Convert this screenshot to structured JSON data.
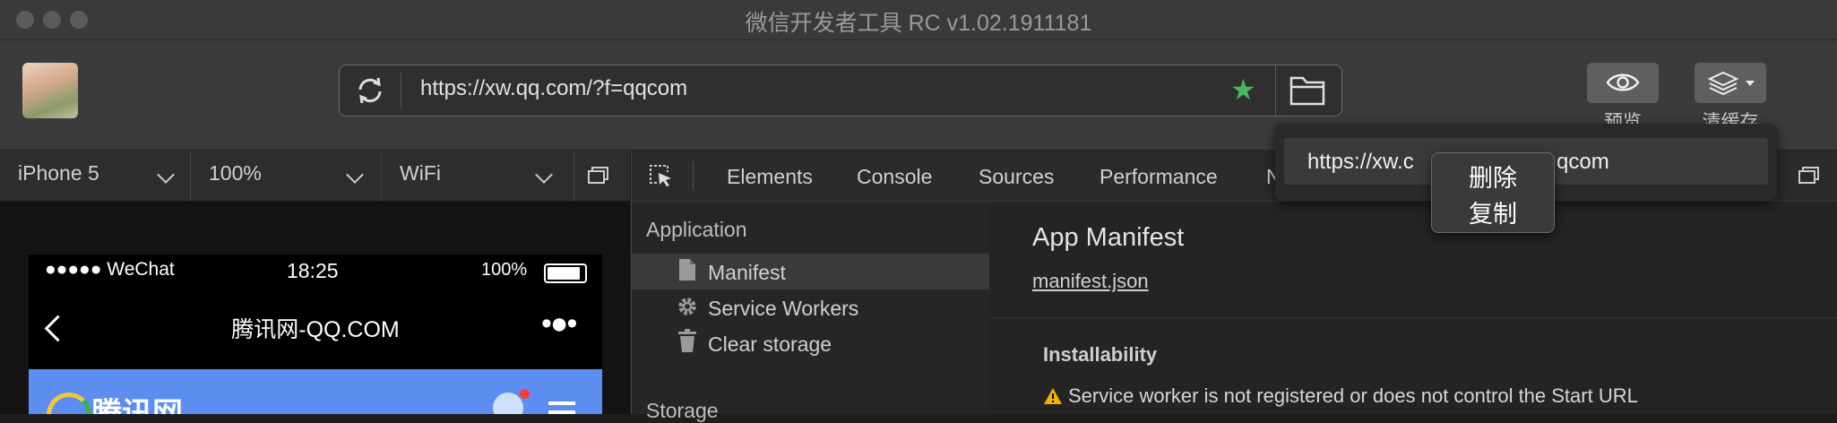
{
  "window": {
    "title": "微信开发者工具 RC v1.02.1911181"
  },
  "toolbar": {
    "url": "https://xw.qq.com/?f=qqcom",
    "preview_label": "预览",
    "clear_cache_label": "清缓存"
  },
  "device_bar": {
    "device": "iPhone 5",
    "zoom": "100%",
    "network": "WiFi"
  },
  "simulator": {
    "status_carrier": "●●●●● WeChat",
    "status_time": "18:25",
    "status_battery": "100%",
    "nav_title": "腾讯网-QQ.COM",
    "nav_more": "•●•",
    "logo_text": "腾讯网"
  },
  "devtools": {
    "tabs": [
      "Elements",
      "Console",
      "Sources",
      "Performance",
      "N"
    ],
    "sidebar": {
      "heading": "Application",
      "items": [
        {
          "label": "Manifest",
          "icon": "file-icon",
          "selected": true
        },
        {
          "label": "Service Workers",
          "icon": "gear-icon"
        },
        {
          "label": "Clear storage",
          "icon": "trash-icon"
        }
      ],
      "storage_heading": "Storage"
    },
    "main": {
      "title": "App Manifest",
      "link": "manifest.json",
      "installability_heading": "Installability",
      "warning_text": "Service worker is not registered or does not control the Start URL"
    }
  },
  "url_popup": {
    "url_left": "https://xw.c",
    "url_right": "qcom"
  },
  "context_menu": {
    "delete": "删除",
    "copy": "复制"
  },
  "colors": {
    "star": "#48b860",
    "phone_header": "#5b8ef0",
    "warning": "#f0b400"
  }
}
